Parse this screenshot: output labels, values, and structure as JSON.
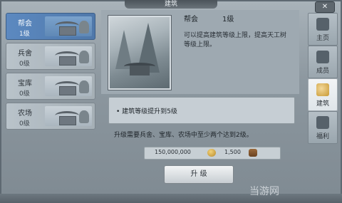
{
  "window": {
    "title": "建筑",
    "close_label": "✕"
  },
  "left_list": {
    "items": [
      {
        "name": "帮会",
        "level": "1级",
        "active": true
      },
      {
        "name": "兵舍",
        "level": "0级",
        "active": false
      },
      {
        "name": "宝库",
        "level": "0级",
        "active": false
      },
      {
        "name": "农场",
        "level": "0级",
        "active": false
      }
    ]
  },
  "detail": {
    "name": "帮会",
    "level": "1级",
    "description": "可以提高建筑等级上限，提高天工树等级上限。",
    "requirement": "• 建筑等级提升到5级",
    "upgrade_note": "升级需要兵舍、宝库、农场中至少两个达到2级。",
    "cost_gold": "150,000,000",
    "cost_wood": "1,500",
    "upgrade_label": "升 级"
  },
  "right_tabs": {
    "items": [
      {
        "label": "主页",
        "icon": "home-icon",
        "active": false
      },
      {
        "label": "成员",
        "icon": "members-icon",
        "active": false
      },
      {
        "label": "建筑",
        "icon": "building-icon",
        "active": true
      },
      {
        "label": "福利",
        "icon": "welfare-icon",
        "active": false
      }
    ]
  },
  "watermark": "当游网"
}
